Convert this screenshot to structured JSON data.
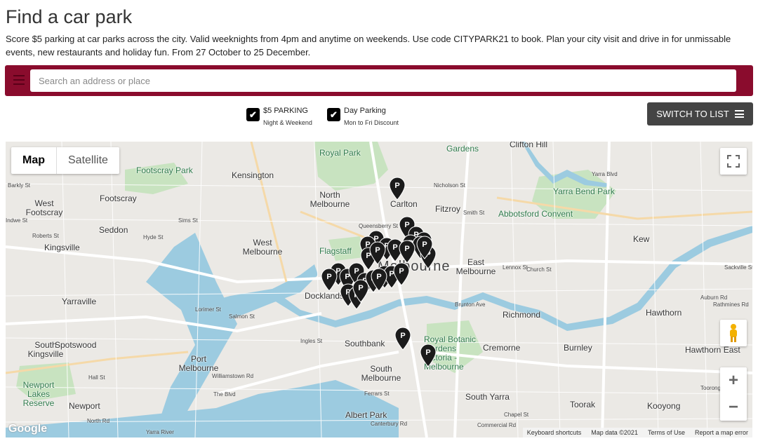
{
  "page": {
    "title": "Find a car park",
    "intro": "Score $5 parking at car parks across the city. Valid weeknights from 4pm and anytime on weekends. Use code CITYPARK21 to book. Plan your city visit and drive in for unmissable events, new restaurants and holiday fun. From 27 October to 25 December."
  },
  "search": {
    "placeholder": "Search an address or place",
    "value": ""
  },
  "filters": [
    {
      "label": "$5 PARKING",
      "sublabel": "Night & Weekend",
      "checked": true
    },
    {
      "label": "Day Parking",
      "sublabel": "Mon to Fri Discount",
      "checked": true
    }
  ],
  "switch_button": {
    "label": "SWITCH TO LIST",
    "icon": "list-icon"
  },
  "map": {
    "type_controls": {
      "map": "Map",
      "satellite": "Satellite",
      "selected": "Map"
    },
    "labels": [
      "Royal Park",
      "Clifton Hill",
      "Footscray Park",
      "Kensington",
      "North Melbourne",
      "Carlton",
      "Fitzroy",
      "Yarra Bend Park",
      "Abbotsford Convent",
      "Footscray",
      "West Footscray",
      "Seddon",
      "Kingsville",
      "West Melbourne",
      "Flagstaff",
      "East Melbourne",
      "Kew",
      "Melbourne",
      "Docklands",
      "Yarraville",
      "Richmond",
      "Hawthorn",
      "South Kingsville",
      "Spotswood",
      "Port Melbourne",
      "Southbank",
      "Royal Botanic Gardens Victoria - Melbourne",
      "Cremorne",
      "Burnley",
      "Hawthorn East",
      "South Melbourne",
      "Newport Lakes Reserve",
      "Newport",
      "South Yarra",
      "Toorak",
      "Kooyong",
      "Albert Park",
      "Gardens"
    ],
    "street_labels": [
      "Barkly St",
      "Indwe St",
      "Roberts St",
      "Hyde St",
      "Sims St",
      "Lorimer St",
      "Salmon St",
      "Ingles St",
      "Williamstown Rd",
      "The Blvd",
      "Hall St",
      "North Rd",
      "Ferrars St",
      "Canterbury Rd",
      "Brunton Ave",
      "Lennox St",
      "Church St",
      "Smith St",
      "Nicholson St",
      "Queensberry St",
      "Sackville St",
      "Rathmines Rd",
      "Auburn Rd",
      "Toorong Rd",
      "Chapel St",
      "Commercial Rd",
      "Yarra Blvd",
      "Yarra River"
    ],
    "pin_label": "P",
    "pin_count": 30,
    "attribution": {
      "google": "Google",
      "shortcuts": "Keyboard shortcuts",
      "data": "Map data ©2021",
      "terms": "Terms of Use",
      "report": "Report a map error"
    }
  },
  "colors": {
    "accent": "#8a0c2d",
    "button": "#444444",
    "water": "#9ccbe0",
    "park": "#c8e3c0"
  }
}
